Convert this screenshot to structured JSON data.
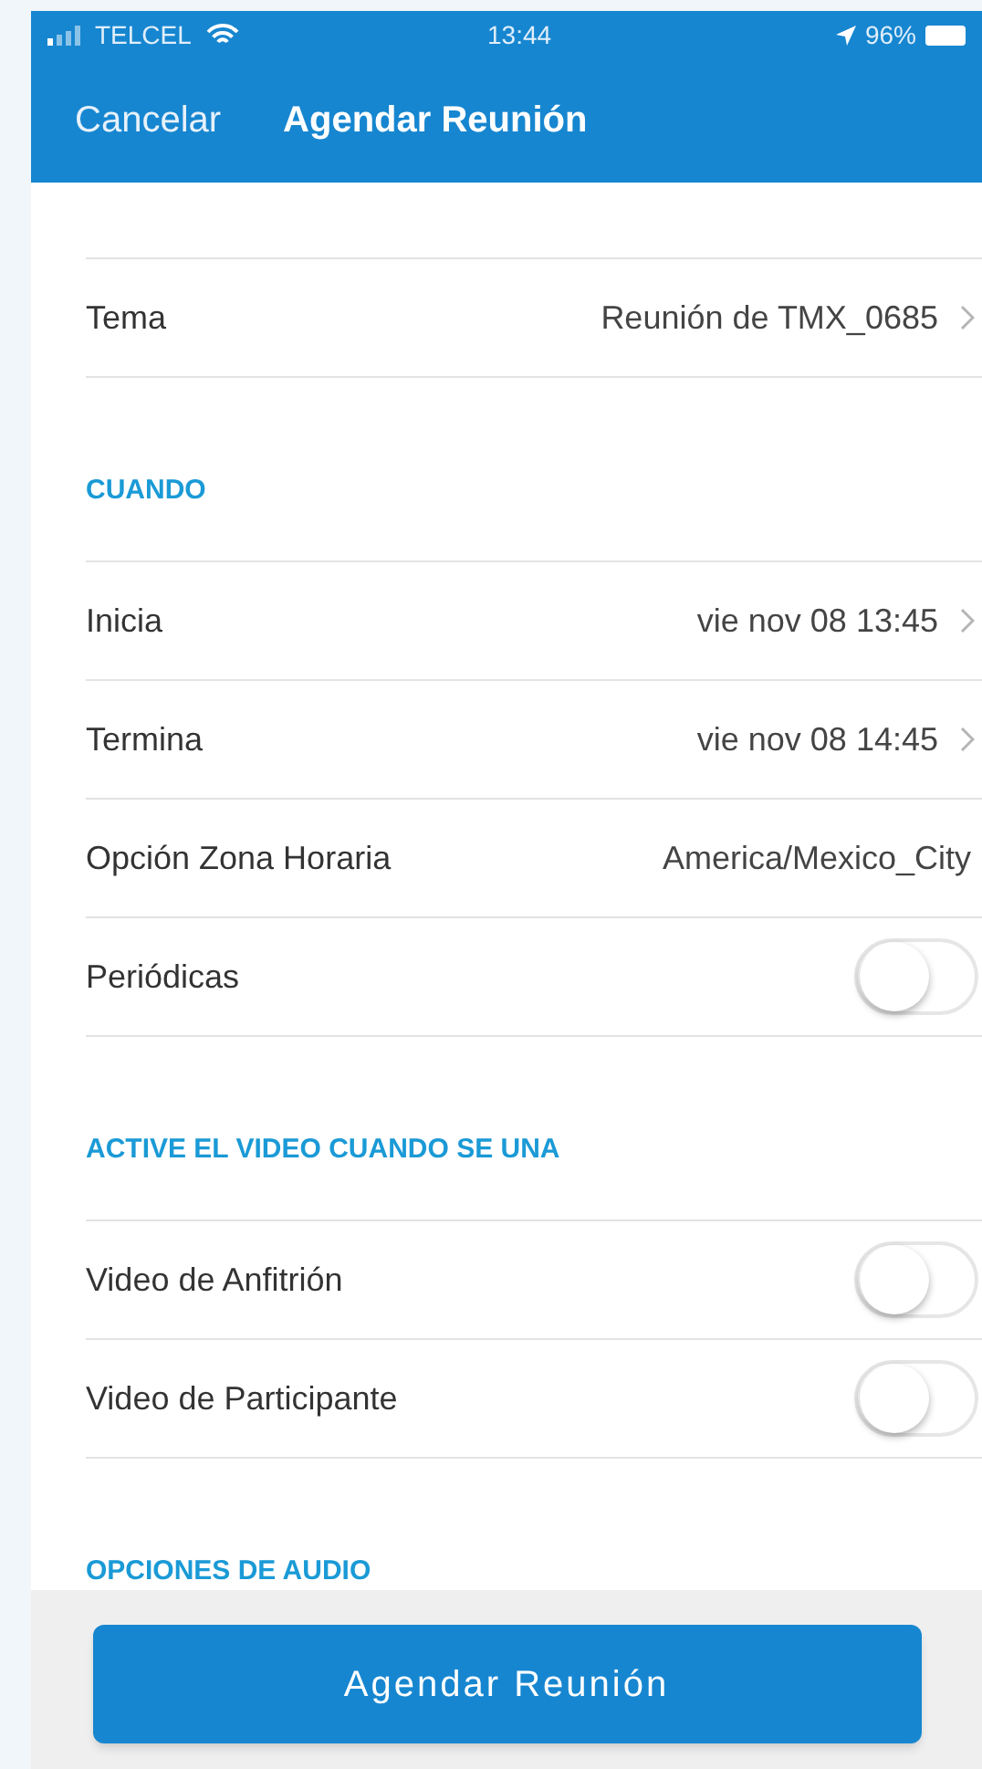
{
  "status_bar": {
    "carrier": "TELCEL",
    "time": "13:44",
    "battery": "96%"
  },
  "nav_bar": {
    "cancel": "Cancelar",
    "title": "Agendar Reunión"
  },
  "sections": [
    {
      "rows": [
        {
          "kind": "nav",
          "label": "Tema",
          "value": "Reunión de TMX_0685"
        }
      ]
    },
    {
      "header": "CUANDO",
      "rows": [
        {
          "kind": "nav",
          "label": "Inicia",
          "value": "vie nov 08 13:45"
        },
        {
          "kind": "nav",
          "label": "Termina",
          "value": "vie nov 08 14:45"
        },
        {
          "kind": "value",
          "label": "Opción Zona Horaria",
          "value": "America/Mexico_City"
        },
        {
          "kind": "toggle",
          "label": "Periódicas",
          "on": false
        }
      ]
    },
    {
      "header": "ACTIVE EL VIDEO CUANDO SE UNA",
      "rows": [
        {
          "kind": "toggle",
          "label": "Video de Anfitrión",
          "on": false
        },
        {
          "kind": "toggle",
          "label": "Video de Participante",
          "on": false
        }
      ]
    },
    {
      "header": "OPCIONES DE AUDIO"
    }
  ],
  "primary_button": "Agendar Reunión"
}
